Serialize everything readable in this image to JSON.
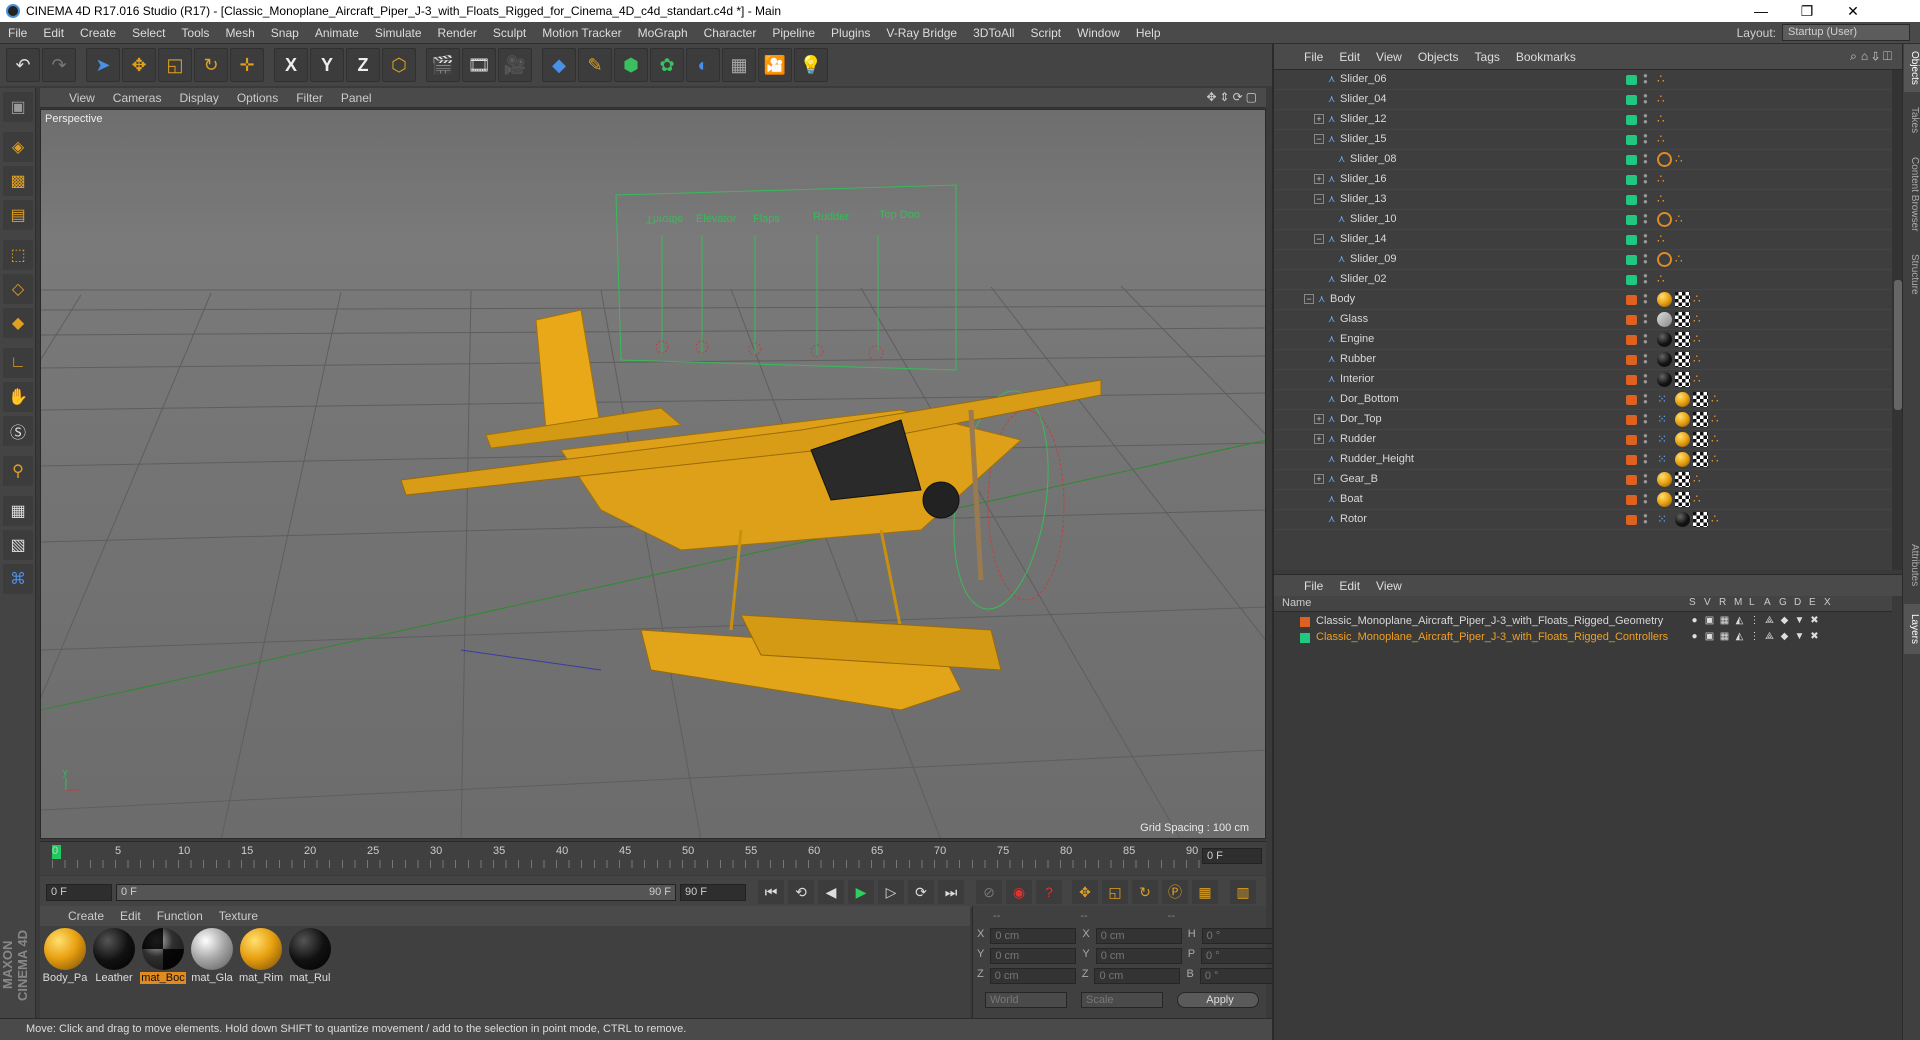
{
  "titlebar": {
    "title": "CINEMA 4D R17.016 Studio (R17) - [Classic_Monoplane_Aircraft_Piper_J-3_with_Floats_Rigged_for_Cinema_4D_c4d_standart.c4d *] - Main",
    "min": "—",
    "max": "❐",
    "close": "✕"
  },
  "menubar": {
    "items": [
      "File",
      "Edit",
      "Create",
      "Select",
      "Tools",
      "Mesh",
      "Snap",
      "Animate",
      "Simulate",
      "Render",
      "Sculpt",
      "Motion Tracker",
      "MoGraph",
      "Character",
      "Pipeline",
      "Plugins",
      "V-Ray Bridge",
      "3DToAll",
      "Script",
      "Window",
      "Help"
    ],
    "layout_label": "Layout:",
    "layout_value": "Startup (User)"
  },
  "toolbar": {
    "x": "X",
    "y": "Y",
    "z": "Z"
  },
  "viewport": {
    "menu": [
      "View",
      "Cameras",
      "Display",
      "Options",
      "Filter",
      "Panel"
    ],
    "label": "Perspective",
    "grid_spacing": "Grid Spacing : 100 cm",
    "controller_labels": [
      "Throttle",
      "Elevator",
      "Flaps",
      "Rudder",
      "Top Doo"
    ]
  },
  "timeline": {
    "ticks": [
      "0",
      "5",
      "10",
      "15",
      "20",
      "25",
      "30",
      "35",
      "40",
      "45",
      "50",
      "55",
      "60",
      "65",
      "70",
      "75",
      "80",
      "85",
      "90"
    ],
    "frame_end": "0 F",
    "start_field": "0 F",
    "range_start": "0 F",
    "range_end": "90 F",
    "end_field": "90 F"
  },
  "materials": {
    "menu": [
      "Create",
      "Edit",
      "Function",
      "Texture"
    ],
    "items": [
      {
        "name": "Body_Pa"
      },
      {
        "name": "Leather"
      },
      {
        "name": "mat_Boc"
      },
      {
        "name": "mat_Gla"
      },
      {
        "name": "mat_Rim"
      },
      {
        "name": "mat_Rul"
      }
    ]
  },
  "coords": {
    "header": [
      "--",
      "--",
      "--"
    ],
    "rows": [
      {
        "a": "X",
        "av": "0 cm",
        "b": "X",
        "bv": "0 cm",
        "c": "H",
        "cv": "0 °"
      },
      {
        "a": "Y",
        "av": "0 cm",
        "b": "Y",
        "bv": "0 cm",
        "c": "P",
        "cv": "0 °"
      },
      {
        "a": "Z",
        "av": "0 cm",
        "b": "Z",
        "bv": "0 cm",
        "c": "B",
        "cv": "0 °"
      }
    ],
    "world": "World",
    "scale": "Scale",
    "apply": "Apply"
  },
  "status": "Move: Click and drag to move elements. Hold down SHIFT to quantize movement / add to the selection in point mode, CTRL to remove.",
  "objects": {
    "menu": [
      "File",
      "Edit",
      "View",
      "Objects",
      "Tags",
      "Bookmarks"
    ],
    "rows": [
      {
        "name": "Slider_06",
        "depth": 2,
        "exp": "",
        "color": "#20c880",
        "tags": [
          "dot"
        ]
      },
      {
        "name": "Slider_04",
        "depth": 2,
        "exp": "",
        "color": "#20c880",
        "tags": [
          "dot"
        ]
      },
      {
        "name": "Slider_12",
        "depth": 2,
        "exp": "+",
        "color": "#20c880",
        "tags": [
          "dot"
        ]
      },
      {
        "name": "Slider_15",
        "depth": 2,
        "exp": "−",
        "color": "#20c880",
        "tags": [
          "dot"
        ]
      },
      {
        "name": "Slider_08",
        "depth": 3,
        "exp": "",
        "color": "#20c880",
        "tags": [
          "ring",
          "dot"
        ]
      },
      {
        "name": "Slider_16",
        "depth": 2,
        "exp": "+",
        "color": "#20c880",
        "tags": [
          "dot"
        ]
      },
      {
        "name": "Slider_13",
        "depth": 2,
        "exp": "−",
        "color": "#20c880",
        "tags": [
          "dot"
        ]
      },
      {
        "name": "Slider_10",
        "depth": 3,
        "exp": "",
        "color": "#20c880",
        "tags": [
          "ring",
          "dot"
        ]
      },
      {
        "name": "Slider_14",
        "depth": 2,
        "exp": "−",
        "color": "#20c880",
        "tags": [
          "dot"
        ]
      },
      {
        "name": "Slider_09",
        "depth": 3,
        "exp": "",
        "color": "#20c880",
        "tags": [
          "ring",
          "dot"
        ]
      },
      {
        "name": "Slider_02",
        "depth": 2,
        "exp": "",
        "color": "#20c880",
        "tags": [
          "dot"
        ]
      },
      {
        "name": "Body",
        "depth": 1,
        "exp": "−",
        "color": "#e06020",
        "tags": [
          "yellow",
          "checker",
          "dot"
        ]
      },
      {
        "name": "Glass",
        "depth": 2,
        "exp": "",
        "color": "#e06020",
        "tags": [
          "glass",
          "checker",
          "dot"
        ]
      },
      {
        "name": "Engine",
        "depth": 2,
        "exp": "",
        "color": "#e06020",
        "tags": [
          "black",
          "checker",
          "dot"
        ]
      },
      {
        "name": "Rubber",
        "depth": 2,
        "exp": "",
        "color": "#e06020",
        "tags": [
          "black",
          "checker",
          "dot"
        ]
      },
      {
        "name": "Interior",
        "depth": 2,
        "exp": "",
        "color": "#e06020",
        "tags": [
          "black",
          "checker",
          "dot"
        ]
      },
      {
        "name": "Dor_Bottom",
        "depth": 2,
        "exp": "",
        "color": "#e06020",
        "tags": [
          "dots",
          "yellow",
          "checker",
          "dot"
        ]
      },
      {
        "name": "Dor_Top",
        "depth": 2,
        "exp": "+",
        "color": "#e06020",
        "tags": [
          "dots",
          "yellow",
          "checker",
          "dot"
        ]
      },
      {
        "name": "Rudder",
        "depth": 2,
        "exp": "+",
        "color": "#e06020",
        "tags": [
          "dots",
          "yellow",
          "checker",
          "dot"
        ]
      },
      {
        "name": "Rudder_Height",
        "depth": 2,
        "exp": "",
        "color": "#e06020",
        "tags": [
          "dots",
          "yellow",
          "checker",
          "dot"
        ]
      },
      {
        "name": "Gear_B",
        "depth": 2,
        "exp": "+",
        "color": "#e06020",
        "tags": [
          "yellow",
          "checker",
          "dot"
        ]
      },
      {
        "name": "Boat",
        "depth": 2,
        "exp": "",
        "color": "#e06020",
        "tags": [
          "yellow",
          "checker",
          "dot"
        ]
      },
      {
        "name": "Rotor",
        "depth": 2,
        "exp": "",
        "color": "#e06020",
        "tags": [
          "dots",
          "black",
          "checker",
          "dot"
        ]
      }
    ]
  },
  "layers": {
    "menu": [
      "File",
      "Edit",
      "View"
    ],
    "name_header": "Name",
    "cols": [
      "S",
      "V",
      "R",
      "M",
      "L",
      "A",
      "G",
      "D",
      "E",
      "X"
    ],
    "rows": [
      {
        "name": "Classic_Monoplane_Aircraft_Piper_J-3_with_Floats_Rigged_Geometry",
        "color": "#e06020",
        "text": "#d8d8d8"
      },
      {
        "name": "Classic_Monoplane_Aircraft_Piper_J-3_with_Floats_Rigged_Controllers",
        "color": "#20c880",
        "text": "#f0a020"
      }
    ]
  },
  "sidetabs": [
    "Objects",
    "Takes",
    "Content Browser",
    "Structure",
    "Attributes",
    "Layers"
  ]
}
